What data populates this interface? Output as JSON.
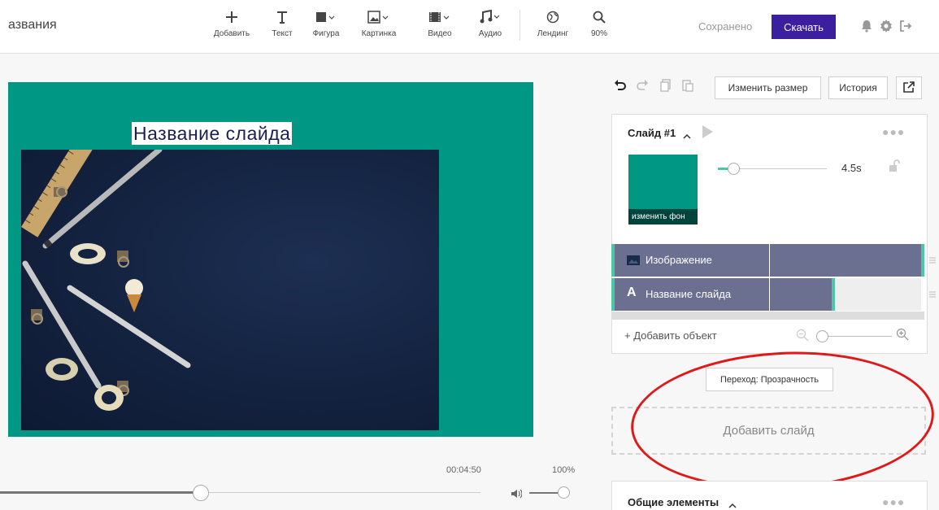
{
  "header": {
    "project_title": "азвания",
    "tools": [
      {
        "label": "Добавить",
        "icon": "plus-icon"
      },
      {
        "label": "Текст",
        "icon": "text-icon"
      },
      {
        "label": "Фигура",
        "icon": "shape-icon"
      },
      {
        "label": "Картинка",
        "icon": "image-icon"
      },
      {
        "label": "Видео",
        "icon": "video-icon"
      },
      {
        "label": "Аудио",
        "icon": "music-icon"
      },
      {
        "label": "Лендинг",
        "icon": "globe-icon"
      },
      {
        "label": "90%",
        "icon": "zoom-icon"
      }
    ],
    "saved_status": "Сохранено",
    "download_label": "Скачать",
    "accent_color": "#3b1f9e"
  },
  "canvas": {
    "slide_title": "Название слайда",
    "background_color": "#009785"
  },
  "playback": {
    "time": "00:04:50",
    "volume": "100%",
    "progress_fraction": 0.41,
    "volume_fraction": 1.0
  },
  "right_toolbar": {
    "resize_label": "Изменить размер",
    "history_label": "История"
  },
  "slide_panel": {
    "slide_name": "Слайд #1",
    "change_bg_label": "изменить фон",
    "duration": "4.5s",
    "duration_fraction": 0.1,
    "layers": [
      {
        "name": "Изображение",
        "icon": "image-layer-icon"
      },
      {
        "name": "Название слайда",
        "icon": "text-layer-icon"
      }
    ],
    "add_object_label": "+ Добавить объект"
  },
  "transition_label": "Переход: Прозрачность",
  "add_slide_label": "Добавить слайд",
  "common_elements_label": "Общие элементы"
}
